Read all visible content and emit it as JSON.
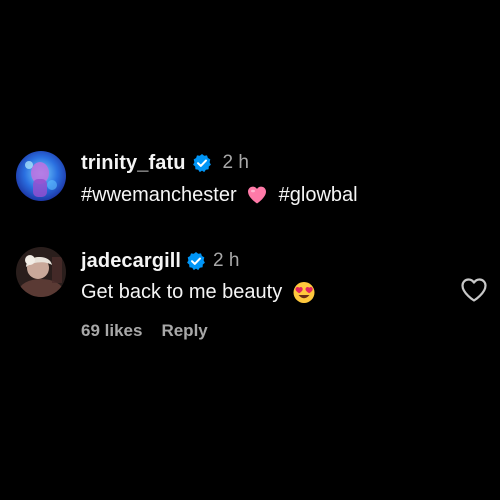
{
  "comments": [
    {
      "username": "trinity_fatu",
      "verified_icon": "verified-badge-icon",
      "time": "2 h",
      "text_before": "#wwemanchester",
      "emoji": "heart-emoji",
      "text_after": "#glowbal"
    },
    {
      "username": "jadecargill",
      "verified_icon": "verified-badge-icon",
      "time": "2 h",
      "text": "Get back to me beauty",
      "emoji": "heart-eyes-emoji",
      "likes": "69 likes",
      "reply_label": "Reply",
      "like_icon": "heart-outline-icon"
    }
  ],
  "colors": {
    "background": "#000000",
    "primary_text": "#f5f5f5",
    "secondary_text": "#a8a8a8",
    "verified_blue": "#0095f6",
    "heart_pink": "#ff7aa8"
  }
}
